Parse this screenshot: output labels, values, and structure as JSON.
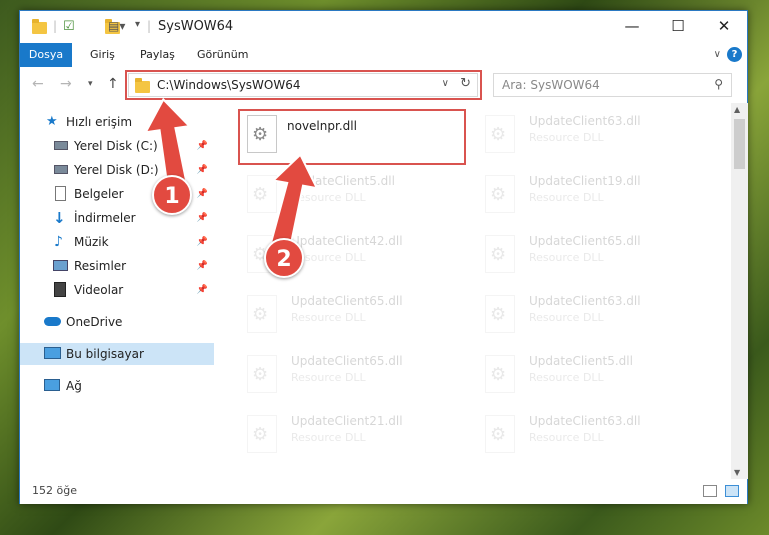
{
  "window": {
    "title": "SysWOW64",
    "minimize": "—",
    "maximize": "☐",
    "close": "✕"
  },
  "ribbon": {
    "tabs": [
      "Dosya",
      "Giriş",
      "Paylaş",
      "Görünüm"
    ]
  },
  "navbar": {
    "address": "C:\\Windows\\SysWOW64",
    "search_placeholder": "Ara: SysWOW64"
  },
  "sidebar": {
    "items": [
      {
        "label": "Hızlı erişim",
        "icon": "star-icon",
        "pinned": false
      },
      {
        "label": "Yerel Disk (C:)",
        "icon": "drive-icon",
        "pinned": true
      },
      {
        "label": "Yerel Disk (D:)",
        "icon": "drive-icon",
        "pinned": true
      },
      {
        "label": "Belgeler",
        "icon": "documents-icon",
        "pinned": true
      },
      {
        "label": "İndirmeler",
        "icon": "download-icon",
        "pinned": true
      },
      {
        "label": "Müzik",
        "icon": "music-icon",
        "pinned": true
      },
      {
        "label": "Resimler",
        "icon": "pictures-icon",
        "pinned": true
      },
      {
        "label": "Videolar",
        "icon": "videos-icon",
        "pinned": true
      },
      {
        "label": "OneDrive",
        "icon": "cloud-icon",
        "pinned": false
      },
      {
        "label": "Bu bilgisayar",
        "icon": "computer-icon",
        "pinned": false,
        "selected": true
      },
      {
        "label": "Ağ",
        "icon": "network-icon",
        "pinned": false
      }
    ]
  },
  "files": {
    "highlighted": {
      "name": "novelnpr.dll",
      "type": ""
    },
    "left_column": [
      {
        "name": "UpdateClient5.dll",
        "type": "Resource DLL"
      },
      {
        "name": "UpdateClient42.dll",
        "type": "Resource DLL"
      },
      {
        "name": "UpdateClient65.dll",
        "type": "Resource DLL"
      },
      {
        "name": "UpdateClient65.dll",
        "type": "Resource DLL"
      },
      {
        "name": "UpdateClient21.dll",
        "type": "Resource DLL"
      }
    ],
    "right_column": [
      {
        "name": "UpdateClient63.dll",
        "type": "Resource DLL"
      },
      {
        "name": "UpdateClient19.dll",
        "type": "Resource DLL"
      },
      {
        "name": "UpdateClient65.dll",
        "type": "Resource DLL"
      },
      {
        "name": "UpdateClient63.dll",
        "type": "Resource DLL"
      },
      {
        "name": "UpdateClient5.dll",
        "type": "Resource DLL"
      },
      {
        "name": "UpdateClient63.dll",
        "type": "Resource DLL"
      }
    ]
  },
  "status": {
    "count": "152 öğe"
  },
  "annotations": {
    "step1": "1",
    "step2": "2",
    "color": "#e24a40"
  }
}
